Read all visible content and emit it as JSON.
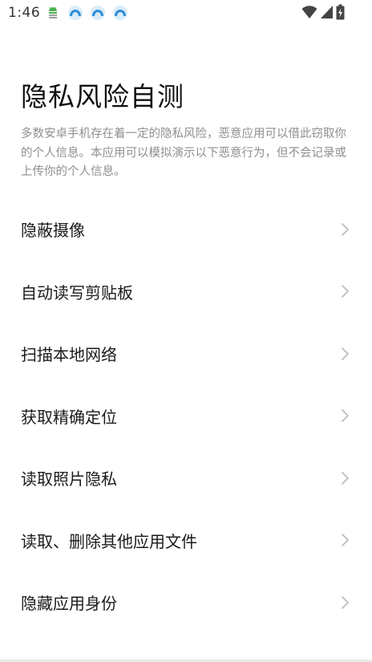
{
  "status_bar": {
    "time": "1:46",
    "notification_icons": [
      "android-debug-icon",
      "app-notification-icon",
      "app-notification-icon",
      "app-notification-icon"
    ],
    "system_icons": [
      "wifi-icon",
      "cellular-signal-icon",
      "battery-charging-icon"
    ]
  },
  "header": {
    "title": "隐私风险自测",
    "description": "多数安卓手机存在着一定的隐私风险，恶意应用可以借此窃取你的个人信息。本应用可以模拟演示以下恶意行为，但不会记录或上传你的个人信息。"
  },
  "menu": {
    "items": [
      {
        "label": "隐蔽摄像"
      },
      {
        "label": "自动读写剪贴板"
      },
      {
        "label": "扫描本地网络"
      },
      {
        "label": "获取精确定位"
      },
      {
        "label": "读取照片隐私"
      },
      {
        "label": "读取、删除其他应用文件"
      },
      {
        "label": "隐藏应用身份"
      }
    ]
  },
  "colors": {
    "background": "#ffffff",
    "title": "#111111",
    "description": "#8f8f8f",
    "chevron": "#bdbdbd",
    "notification_icon": "#2e8fd6"
  }
}
